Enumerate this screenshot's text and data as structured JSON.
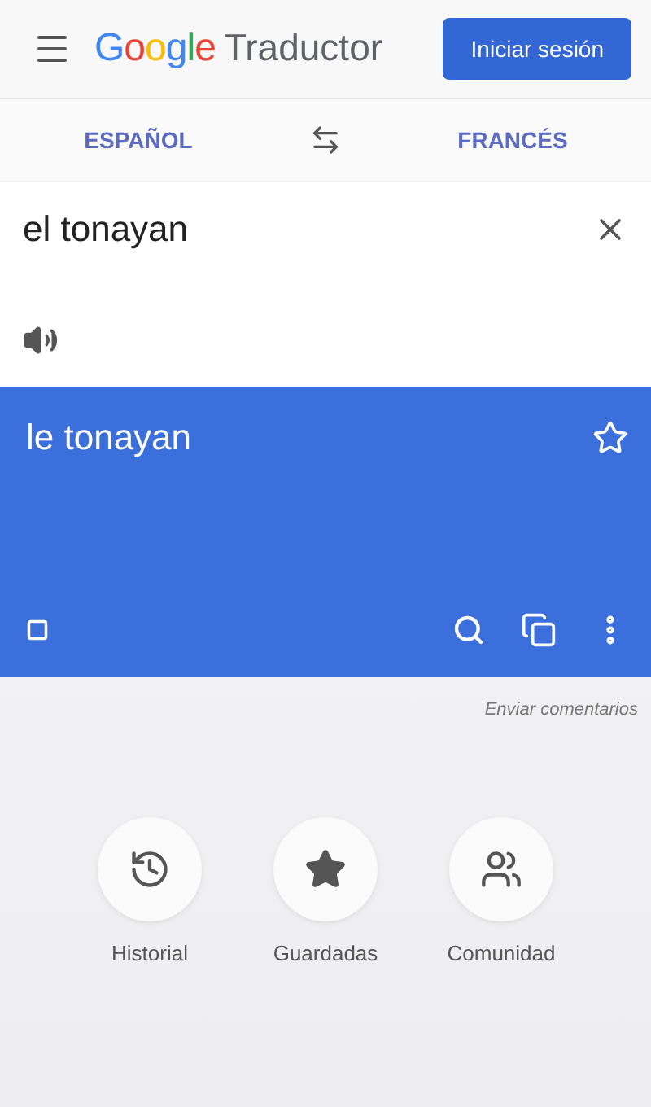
{
  "header": {
    "logo": "Google",
    "product": "Traductor",
    "sign_in": "Iniciar sesión"
  },
  "languages": {
    "source": "ESPAÑOL",
    "target": "FRANCÉS"
  },
  "input": {
    "value": "el tonayan"
  },
  "output": {
    "text": "le tonayan",
    "starred": false
  },
  "feedback": "Enviar comentarios",
  "shortcuts": [
    {
      "kind": "history",
      "label": "Historial"
    },
    {
      "kind": "saved",
      "label": "Guardadas"
    },
    {
      "kind": "community",
      "label": "Comunidad"
    }
  ]
}
